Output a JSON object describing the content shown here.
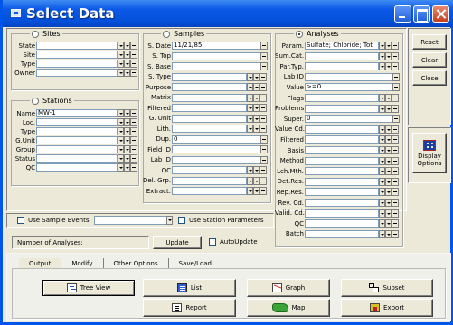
{
  "window": {
    "title": "Select Data"
  },
  "sites": {
    "header": "Sites",
    "rows": [
      {
        "label": "State",
        "value": ""
      },
      {
        "label": "Site",
        "value": ""
      },
      {
        "label": "Type",
        "value": ""
      },
      {
        "label": "Owner",
        "value": ""
      }
    ]
  },
  "stations": {
    "header": "Stations",
    "rows": [
      {
        "label": "Name",
        "value": "MW-1"
      },
      {
        "label": "Loc.",
        "value": ""
      },
      {
        "label": "Type",
        "value": ""
      },
      {
        "label": "G.Unit",
        "value": ""
      },
      {
        "label": "Group",
        "value": ""
      },
      {
        "label": "Status",
        "value": ""
      },
      {
        "label": "QC",
        "value": ""
      }
    ]
  },
  "samples": {
    "header": "Samples",
    "rows": [
      {
        "label": "S. Date",
        "value": "11/21/85",
        "kind": "text"
      },
      {
        "label": "S. Top",
        "value": "",
        "kind": "text"
      },
      {
        "label": "S. Base",
        "value": "",
        "kind": "text"
      },
      {
        "label": "S. Type",
        "value": "",
        "kind": "dd"
      },
      {
        "label": "Purpose",
        "value": "",
        "kind": "dd"
      },
      {
        "label": "Matrix",
        "value": "",
        "kind": "dd"
      },
      {
        "label": "Filtered",
        "value": "",
        "kind": "dd"
      },
      {
        "label": "G. Unit",
        "value": "",
        "kind": "dd"
      },
      {
        "label": "Lith.",
        "value": "",
        "kind": "dd"
      },
      {
        "label": "Dup.",
        "value": "0",
        "kind": "text"
      },
      {
        "label": "Field ID",
        "value": "",
        "kind": "text"
      },
      {
        "label": "Lab ID",
        "value": "",
        "kind": "text"
      },
      {
        "label": "QC",
        "value": "",
        "kind": "dd"
      },
      {
        "label": "Del. Grp.",
        "value": "",
        "kind": "dd"
      },
      {
        "label": "Extract.",
        "value": "",
        "kind": "dd"
      }
    ]
  },
  "analyses": {
    "header": "Analyses",
    "rows": [
      {
        "label": "Param.",
        "value": "Sulfate; Chloride; Tot",
        "kind": "dd"
      },
      {
        "label": "Sum.Cat.",
        "value": "",
        "kind": "dd"
      },
      {
        "label": "Par.Typ.",
        "value": "",
        "kind": "dd"
      },
      {
        "label": "Lab ID",
        "value": "",
        "kind": "text"
      },
      {
        "label": "Value",
        "value": ">=0",
        "kind": "text"
      },
      {
        "label": "Flags",
        "value": "",
        "kind": "dd"
      },
      {
        "label": "Problems",
        "value": "",
        "kind": "dd"
      },
      {
        "label": "Super.",
        "value": "0",
        "kind": "text"
      },
      {
        "label": "Value Cd.",
        "value": "",
        "kind": "dd"
      },
      {
        "label": "Filtered",
        "value": "",
        "kind": "dd"
      },
      {
        "label": "Basis",
        "value": "",
        "kind": "dd"
      },
      {
        "label": "Method",
        "value": "",
        "kind": "dd"
      },
      {
        "label": "Lch.Mth.",
        "value": "",
        "kind": "dd"
      },
      {
        "label": "Det.Res.",
        "value": "",
        "kind": "dd"
      },
      {
        "label": "Rep.Res.",
        "value": "",
        "kind": "dd"
      },
      {
        "label": "Rev. Cd.",
        "value": "",
        "kind": "dd"
      },
      {
        "label": "Valid. Cd.",
        "value": "",
        "kind": "dd"
      },
      {
        "label": "QC",
        "value": "",
        "kind": "dd"
      },
      {
        "label": "Batch",
        "value": "",
        "kind": "dd"
      }
    ]
  },
  "side_buttons": {
    "reset": "Reset",
    "clear": "Clear",
    "close": "Close",
    "display_options": "Display Options"
  },
  "options": {
    "use_sample_events": "Use Sample Events",
    "use_station_parameters": "Use Station Parameters",
    "number_of_analyses": "Number of Analyses:",
    "update": "Update",
    "autoupdate": "AutoUpdate"
  },
  "tabs": [
    "Output",
    "Modify",
    "Other Options",
    "Save/Load"
  ],
  "output_buttons": {
    "tree_view": "Tree View",
    "list": "List",
    "graph": "Graph",
    "subset": "Subset",
    "report": "Report",
    "map": "Map",
    "export": "Export"
  },
  "colors": {
    "titlebar": "#0a58e6",
    "window_bg": "#ece9d8",
    "border": "#0055ea"
  }
}
